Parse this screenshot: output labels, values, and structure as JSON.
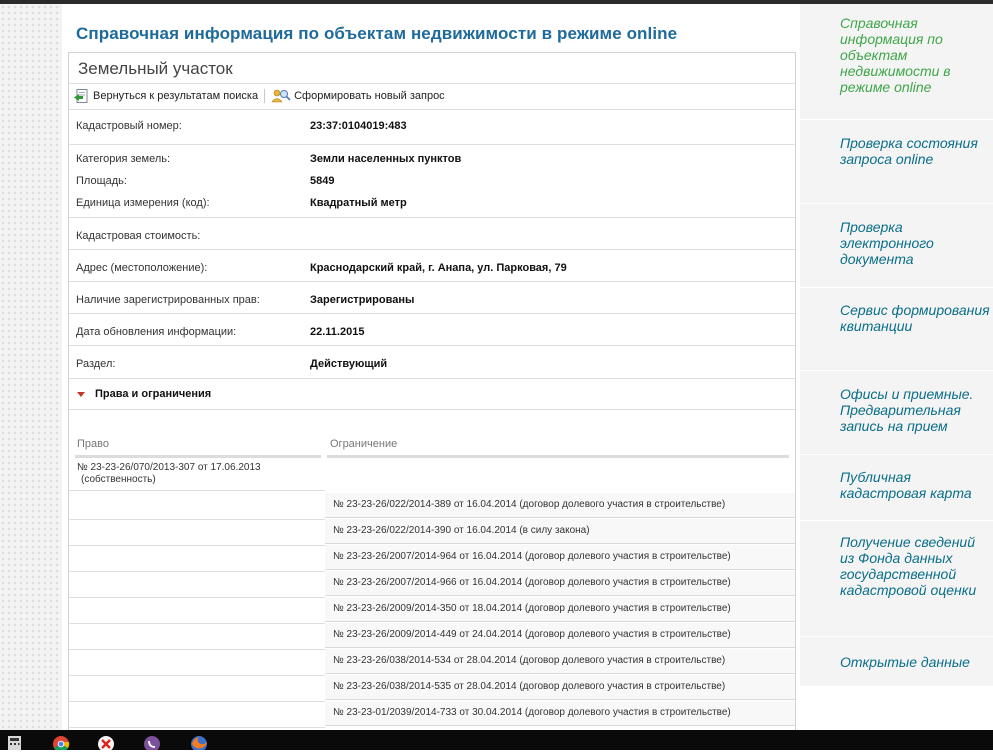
{
  "page_title": "Справочная информация по объектам недвижимости в режиме online",
  "card_title": "Земельный участок",
  "actions": {
    "back": "Вернуться к результатам поиска",
    "new_request": "Сформировать новый запрос"
  },
  "fields": [
    {
      "label": "Кадастровый номер:",
      "value": "23:37:0104019:483"
    },
    {
      "label": "Категория земель:",
      "value": "Земли населенных пунктов"
    },
    {
      "label": "Площадь:",
      "value": "5849"
    },
    {
      "label": "Единица измерения (код):",
      "value": "Квадратный метр"
    },
    {
      "label": "Кадастровая стоимость:",
      "value": ""
    },
    {
      "label": "Адрес (местоположение):",
      "value": "Краснодарский край, г. Анапа, ул. Парковая, 79"
    },
    {
      "label": "Наличие зарегистрированных прав:",
      "value": "Зарегистрированы"
    },
    {
      "label": "Дата обновления информации:",
      "value": "22.11.2015"
    },
    {
      "label": "Раздел:",
      "value": "Действующий"
    }
  ],
  "rights_section": "Права и ограничения",
  "rights_table": {
    "col_right": "Право",
    "col_restriction": "Ограничение",
    "right_line1": "№ 23-23-26/070/2013-307  от 17.06.2013",
    "right_line2": "(собственность)",
    "restrictions": [
      "№ 23-23-26/022/2014-389  от 16.04.2014  (договор долевого участия в строительстве)",
      "№ 23-23-26/022/2014-390  от 16.04.2014  (в силу закона)",
      "№ 23-23-26/2007/2014-964  от 16.04.2014  (договор долевого участия в строительстве)",
      "№ 23-23-26/2007/2014-966  от 16.04.2014  (договор долевого участия в строительстве)",
      "№ 23-23-26/2009/2014-350  от 18.04.2014  (договор долевого участия в строительстве)",
      "№ 23-23-26/2009/2014-449  от 24.04.2014  (договор долевого участия в строительстве)",
      "№ 23-23-26/038/2014-534  от 28.04.2014  (договор долевого участия в строительстве)",
      "№ 23-23-26/038/2014-535  от 28.04.2014  (договор долевого участия в строительстве)",
      "№ 23-23-01/2039/2014-733  от 30.04.2014  (договор долевого участия в строительстве)"
    ]
  },
  "sidebar": {
    "items": [
      "Справочная информация по объектам недвижимости в режиме online",
      "Проверка состояния запроса online",
      "Проверка электронного документа",
      "Сервис формирования квитанции",
      "Офисы и приемные. Предварительная запись на прием",
      "Публичная кадастровая карта",
      "Получение сведений из Фонда данных государственной кадастровой оценки",
      "Открытые данные"
    ]
  },
  "colors": {
    "title_blue": "#1e6a9a",
    "sidebar_link": "#0a6e8a",
    "sidebar_active": "#3fa64a",
    "section_marker": "#c0392b"
  },
  "icons": [
    "document-back-icon",
    "people-search-icon",
    "calculator-icon",
    "chrome-icon",
    "yandex-icon",
    "viber-icon",
    "firefox-icon"
  ]
}
